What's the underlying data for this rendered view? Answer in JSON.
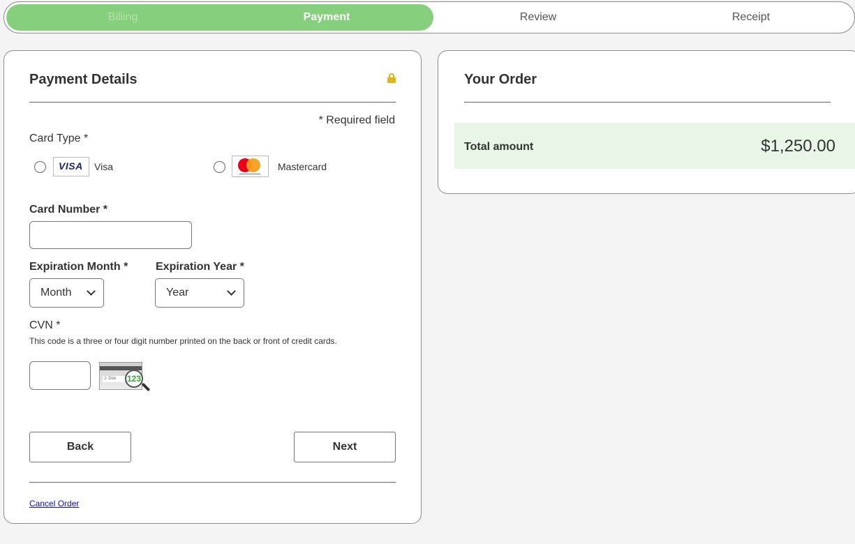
{
  "steps": {
    "billing": "Billing",
    "payment": "Payment",
    "review": "Review",
    "receipt": "Receipt"
  },
  "payment": {
    "title": "Payment Details",
    "required_note": "* Required field",
    "card_type_label": "Card Type *",
    "card_types": [
      {
        "name": "Visa",
        "logo_text": "VISA"
      },
      {
        "name": "Mastercard"
      }
    ],
    "card_number_label": "Card Number *",
    "card_number_value": "",
    "exp_month_label": "Expiration Month *",
    "exp_month_value": "Month",
    "exp_year_label": "Expiration Year *",
    "exp_year_value": "Year",
    "cvn_label": "CVN *",
    "cvn_help": "This code is a three or four digit number printed on the back or front of credit cards.",
    "cvn_value": "",
    "cvn_image_digits": "123",
    "back_label": "Back",
    "next_label": "Next",
    "cancel_label": "Cancel Order"
  },
  "order": {
    "title": "Your Order",
    "total_label": "Total amount",
    "total_value": "$1,250.00"
  },
  "colors": {
    "progress_fill": "#86cf7c",
    "total_bg": "#e9f5e7",
    "lock": "#e2b418",
    "link": "#0a0ac9"
  }
}
